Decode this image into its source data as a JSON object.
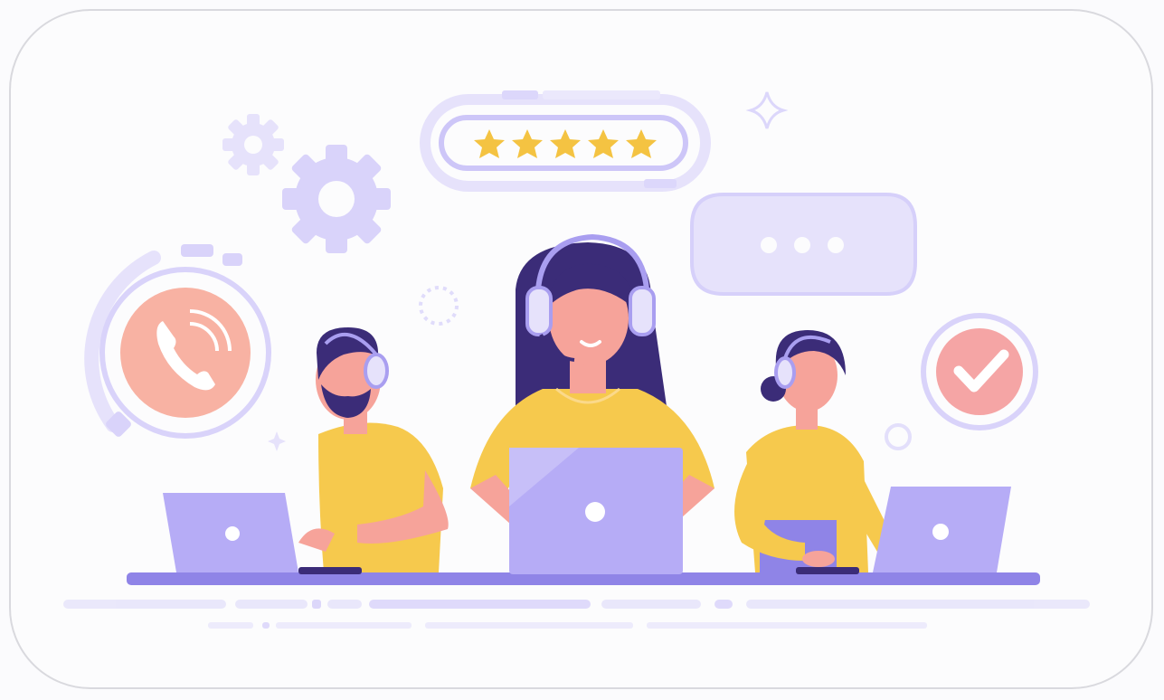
{
  "illustration": {
    "subject": "customer-support-team",
    "rating": {
      "stars": 5,
      "max": 5
    },
    "colors": {
      "purple": "#a99ef0",
      "purple_light": "#e6e2fb",
      "purple_dark": "#8d80e6",
      "navy_hair": "#3b2c78",
      "skin": "#f6a39a",
      "skin_light": "#f7b2a8",
      "yellow_shirt": "#f6c94d",
      "star": "#f4c342",
      "phone_circle": "#f8b2a3",
      "check_circle": "#f5a5a5",
      "laptop": "#b6acf6",
      "desk": "#8f84e7"
    },
    "icons": [
      "phone-icon",
      "gear-icon",
      "star-icon",
      "speech-bubble-icon",
      "checkmark-icon",
      "headset-icon",
      "laptop-icon"
    ]
  }
}
